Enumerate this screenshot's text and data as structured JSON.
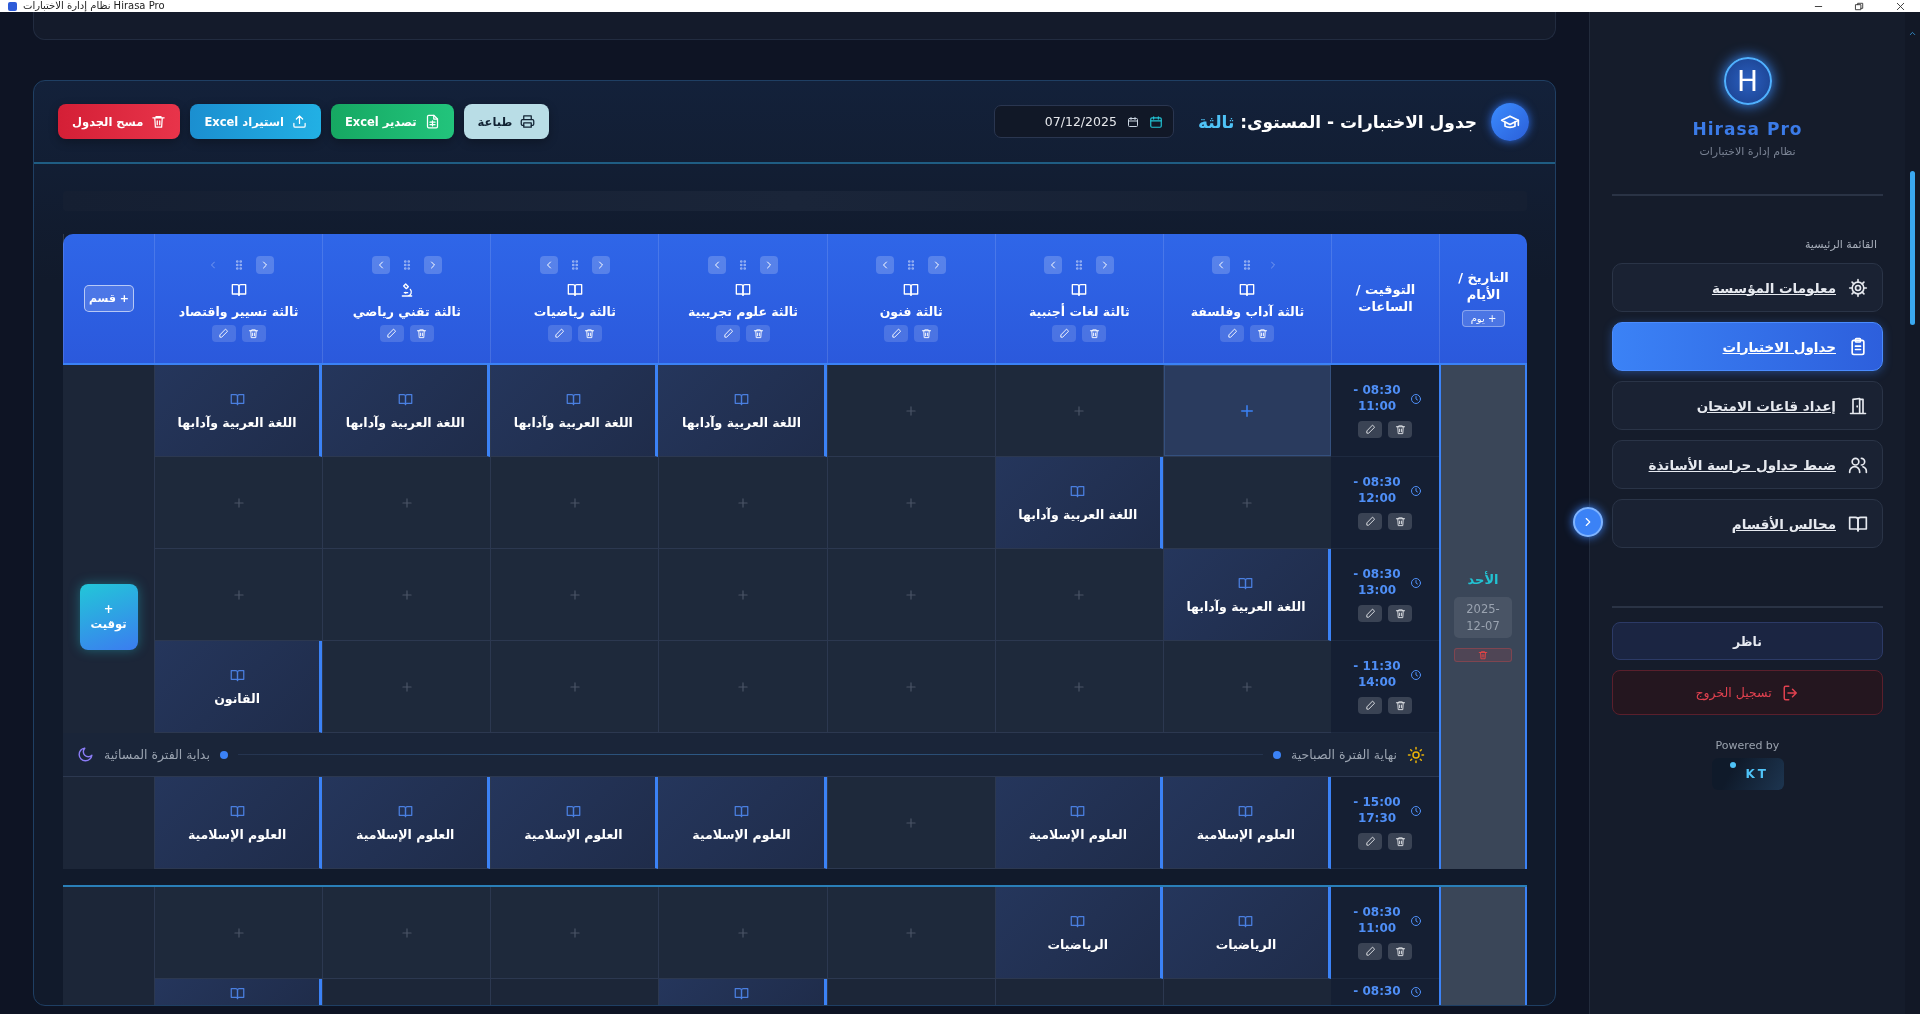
{
  "window": {
    "title": "نظام إدارة الاختبارات Hirasa Pro"
  },
  "sidebar": {
    "logo_letter": "H",
    "app_name": "Hirasa Pro",
    "subtitle": "نظام إدارة الاختبارات",
    "section_title": "القائمة الرئيسية",
    "items": [
      {
        "label": "معلومات المؤسسة",
        "kind": "gear",
        "selected": false
      },
      {
        "label": "جداول الاختبارات",
        "kind": "clipboard",
        "selected": true
      },
      {
        "label": "إعداد قاعات الامتحان",
        "kind": "door",
        "selected": false
      },
      {
        "label": "ضبط جداول حراسة الأساتذة",
        "kind": "people",
        "selected": false
      },
      {
        "label": "مجالس الأقسام",
        "kind": "book",
        "selected": false
      }
    ],
    "user_role": "ناظر",
    "logout": "تسجيل الخروج",
    "powered_by": "Powered by",
    "vendor_logo": "KT"
  },
  "schedule": {
    "title": "جدول الاختبارات - المستوى:",
    "level": "ثالثة",
    "date": "07/12/2025",
    "buttons": [
      {
        "label": "طباعة",
        "kind": "print"
      },
      {
        "label": "تصدير Excel",
        "kind": "export"
      },
      {
        "label": "استيراد Excel",
        "kind": "import"
      },
      {
        "label": "مسح الجدول",
        "kind": "clear"
      }
    ],
    "corner_day": "التاريخ / الأيام",
    "add_day": "+ يوم",
    "corner_time": "التوقيت / الساعات",
    "add_section": "+ قسم",
    "columns": [
      {
        "name": "ثالثة آداب وفلسفة",
        "kind": "book",
        "left_disabled": false,
        "right_disabled": true
      },
      {
        "name": "ثالثة لغات أجنبية",
        "kind": "book",
        "left_disabled": false,
        "right_disabled": false
      },
      {
        "name": "ثالثة فنون",
        "kind": "book",
        "left_disabled": false,
        "right_disabled": false
      },
      {
        "name": "ثالثة علوم تجريبية",
        "kind": "book",
        "left_disabled": false,
        "right_disabled": false
      },
      {
        "name": "ثالثة رياضيات",
        "kind": "book",
        "left_disabled": false,
        "right_disabled": false
      },
      {
        "name": "ثالثة تقني رياضي",
        "kind": "science",
        "left_disabled": false,
        "right_disabled": false
      },
      {
        "name": "ثالثة تسيير واقتصاد",
        "kind": "book",
        "left_disabled": true,
        "right_disabled": false
      }
    ],
    "days": [
      {
        "name": "الأحد",
        "date": "2025-12-07",
        "add_time": "+ توقيت",
        "morning_end": "نهاية الفترة الصباحية",
        "evening_start": "بداية الفترة المسائية",
        "morning_slots": [
          {
            "time": "08:30 - 11:00",
            "cut": false,
            "cells": [
              {
                "kind": "empty",
                "hover": true
              },
              {
                "kind": "empty",
                "hover": false
              },
              {
                "kind": "empty",
                "hover": false
              },
              {
                "kind": "exam",
                "subject": "اللغة العربية وآدابها",
                "hover": false
              },
              {
                "kind": "exam",
                "subject": "اللغة العربية وآدابها",
                "hover": false
              },
              {
                "kind": "exam",
                "subject": "اللغة العربية وآدابها",
                "hover": false
              },
              {
                "kind": "exam",
                "subject": "اللغة العربية وآدابها",
                "hover": false
              }
            ]
          },
          {
            "time": "08:30 - 12:00",
            "cut": false,
            "cells": [
              {
                "kind": "empty",
                "hover": false
              },
              {
                "kind": "exam",
                "subject": "اللغة العربية وآدابها",
                "hover": false
              },
              {
                "kind": "empty",
                "hover": false
              },
              {
                "kind": "empty",
                "hover": false
              },
              {
                "kind": "empty",
                "hover": false
              },
              {
                "kind": "empty",
                "hover": false
              },
              {
                "kind": "empty",
                "hover": false
              }
            ]
          },
          {
            "time": "08:30 - 13:00",
            "cut": false,
            "cells": [
              {
                "kind": "exam",
                "subject": "اللغة العربية وآدابها",
                "hover": false
              },
              {
                "kind": "empty",
                "hover": false
              },
              {
                "kind": "empty",
                "hover": false
              },
              {
                "kind": "empty",
                "hover": false
              },
              {
                "kind": "empty",
                "hover": false
              },
              {
                "kind": "empty",
                "hover": false
              },
              {
                "kind": "empty",
                "hover": false
              }
            ]
          },
          {
            "time": "11:30 - 14:00",
            "cut": false,
            "cells": [
              {
                "kind": "empty",
                "hover": false
              },
              {
                "kind": "empty",
                "hover": false
              },
              {
                "kind": "empty",
                "hover": false
              },
              {
                "kind": "empty",
                "hover": false
              },
              {
                "kind": "empty",
                "hover": false
              },
              {
                "kind": "empty",
                "hover": false
              },
              {
                "kind": "exam",
                "subject": "القانون",
                "hover": false
              }
            ]
          }
        ],
        "evening_slots": [
          {
            "time": "15:00 - 17:30",
            "cut": false,
            "cells": [
              {
                "kind": "exam",
                "subject": "العلوم الإسلامية",
                "hover": false
              },
              {
                "kind": "exam",
                "subject": "العلوم الإسلامية",
                "hover": false
              },
              {
                "kind": "empty",
                "hover": false
              },
              {
                "kind": "exam",
                "subject": "العلوم الإسلامية",
                "hover": false
              },
              {
                "kind": "exam",
                "subject": "العلوم الإسلامية",
                "hover": false
              },
              {
                "kind": "exam",
                "subject": "العلوم الإسلامية",
                "hover": false
              },
              {
                "kind": "exam",
                "subject": "العلوم الإسلامية",
                "hover": false
              }
            ]
          }
        ]
      },
      {
        "morning_slots": [
          {
            "time": "08:30 - 11:00",
            "cut": false,
            "cells": [
              {
                "kind": "exam",
                "subject": "الرياضيات",
                "hover": false
              },
              {
                "kind": "exam",
                "subject": "الرياضيات",
                "hover": false
              },
              {
                "kind": "empty",
                "hover": false
              },
              {
                "kind": "empty",
                "hover": false
              },
              {
                "kind": "empty",
                "hover": false
              },
              {
                "kind": "empty",
                "hover": false
              },
              {
                "kind": "empty",
                "hover": false
              }
            ]
          },
          {
            "time": "08:30 -",
            "cut": true,
            "cells": [
              {
                "kind": "empty"
              },
              {
                "kind": "empty"
              },
              {
                "kind": "empty"
              },
              {
                "kind": "exam"
              },
              {
                "kind": "empty"
              },
              {
                "kind": "empty"
              },
              {
                "kind": "exam"
              }
            ]
          }
        ]
      }
    ]
  }
}
